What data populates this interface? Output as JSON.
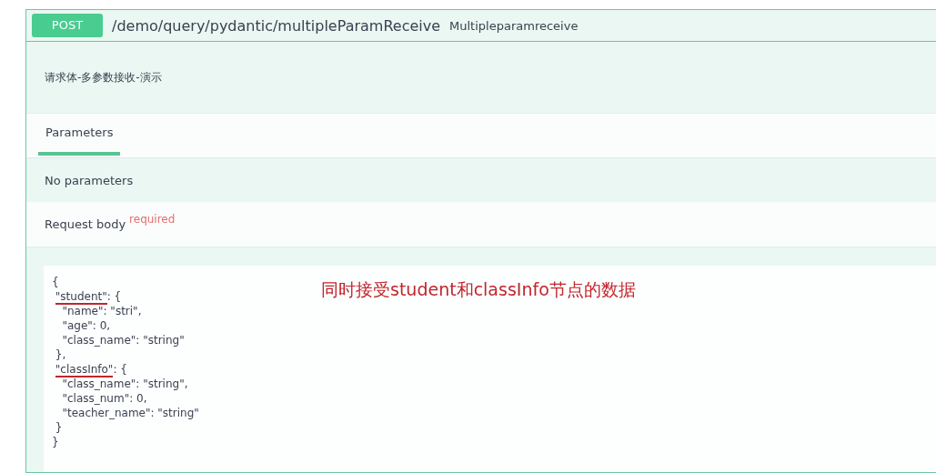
{
  "operation": {
    "method": "POST",
    "path": "/demo/query/pydantic/multipleParamReceive",
    "summary": "Multipleparamreceive",
    "description": "请求体-多参数接收-演示"
  },
  "tabs": [
    {
      "label": "Parameters",
      "selected": true
    }
  ],
  "parameters_message": "No parameters",
  "request_body": {
    "label": "Request body",
    "badge": "required"
  },
  "example": {
    "lines": [
      {
        "text": "{",
        "marked": false
      },
      {
        "text": " \"student\": {",
        "marked": true
      },
      {
        "text": "   \"name\": \"stri\",",
        "marked": false
      },
      {
        "text": "   \"age\": 0,",
        "marked": false
      },
      {
        "text": "   \"class_name\": \"string\"",
        "marked": false
      },
      {
        "text": " },",
        "marked": false
      },
      {
        "text": " \"classInfo\": {",
        "marked": true
      },
      {
        "text": "   \"class_name\": \"string\",",
        "marked": false
      },
      {
        "text": "   \"class_num\": 0,",
        "marked": false
      },
      {
        "text": "   \"teacher_name\": \"string\"",
        "marked": false
      },
      {
        "text": " }",
        "marked": false
      },
      {
        "text": "}",
        "marked": false
      }
    ],
    "annotation": "同时接受student和classInfo节点的数据"
  }
}
